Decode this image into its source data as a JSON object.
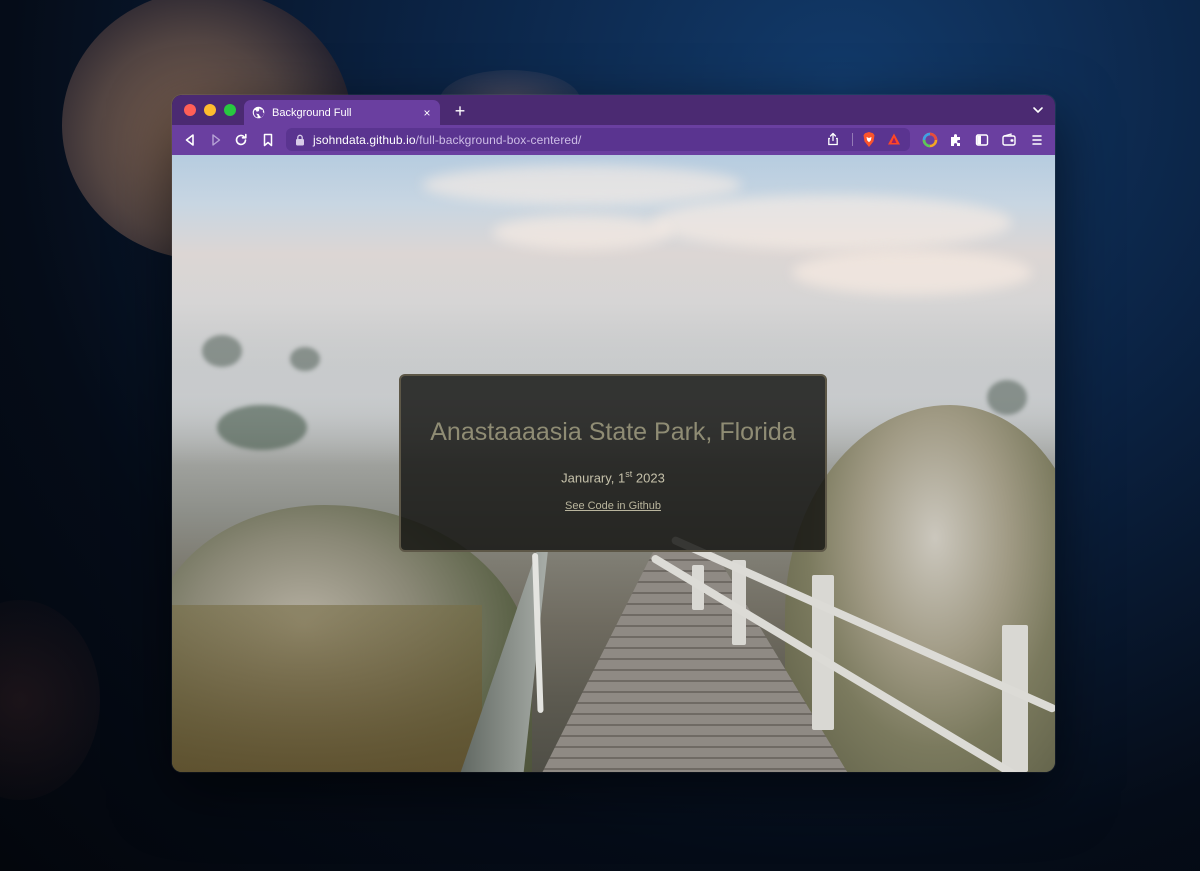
{
  "browser": {
    "tab": {
      "title": "Background Full",
      "close_label": "×"
    },
    "new_tab_label": "+",
    "url": {
      "domain": "jsohndata.github.io",
      "path": "/full-background-box-centered/"
    }
  },
  "page": {
    "title": "Anastaaaasia State Park, Florida",
    "date_prefix": "Janurary, 1",
    "date_suffix": "st",
    "date_year": " 2023",
    "link_label": "See Code in Github"
  },
  "colors": {
    "tabbar": "#4b2a72",
    "toolbar": "#6a3fa0",
    "card_bg": "#121210",
    "card_title": "#8f8c74"
  },
  "icons": [
    "globe-icon",
    "close-icon",
    "plus-icon",
    "chevron-down-icon",
    "back-icon",
    "forward-icon",
    "reload-icon",
    "bookmark-icon",
    "lock-icon",
    "share-icon",
    "brave-shield-icon",
    "bat-icon",
    "color-wheel-icon",
    "extensions-icon",
    "sidebar-icon",
    "wallet-icon",
    "menu-icon"
  ]
}
